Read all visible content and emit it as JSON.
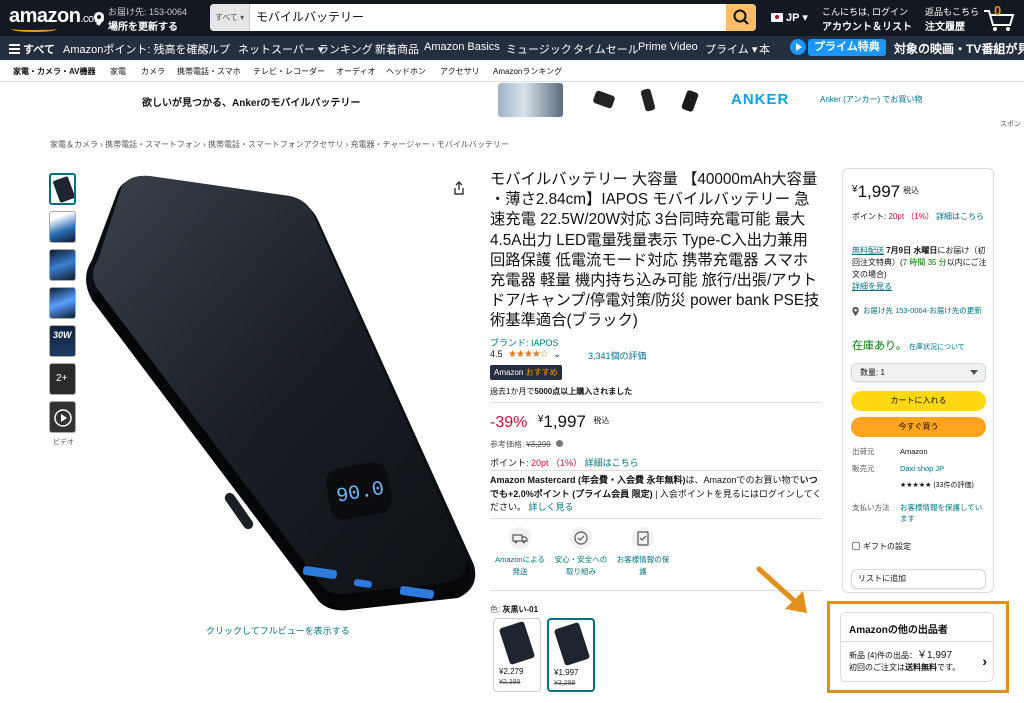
{
  "header": {
    "logo": "amazon",
    "logo_tld": ".co.jp",
    "deliver_to": "お届け先: 153-0064",
    "deliver_update": "場所を更新する",
    "search_category": "すべて",
    "search_value": "モバイルバッテリー",
    "lang": "JP",
    "account_top": "こんにちは, ログイン",
    "account_bottom": "アカウント＆リスト",
    "orders_top": "返品もこちら",
    "orders_bottom": "注文履歴",
    "cart_count": "0",
    "cart_label": "カート"
  },
  "nav": {
    "all": "すべて",
    "items": [
      "Amazonポイント: 残高を確認",
      "ヘルプ",
      "ネットスーパー",
      "ランキング",
      "新着商品",
      "Amazon Basics",
      "ミュージック",
      "タイムセール",
      "Prime Video",
      "プライム",
      "本"
    ],
    "prime_badge": "プライム特典",
    "prime_text": "対象の映画・TV番組が見"
  },
  "subnav": [
    "家電・カメラ・AV機器",
    "家電",
    "カメラ",
    "携帯電話・スマホ",
    "テレビ・レコーダー",
    "オーディオ",
    "ヘッドホン",
    "アクセサリ",
    "Amazonランキング"
  ],
  "ad": {
    "text": "欲しいが見つかる、Ankerのモバイルバッテリー",
    "brand": "ANKER",
    "link": "Anker (アンカー) でお買い物",
    "sponsored": "スポン"
  },
  "breadcrumb": "家電＆カメラ › 携帯電話・スマートフォン › 携帯電話・スマートフォンアクセサリ › 充電器・チャージャー › モバイルバッテリー",
  "gallery": {
    "video_label": "ビデオ",
    "fullview": "クリックしてフルビューを表示する",
    "thumb_text_30w": "30W",
    "thumb_text_2plus": "2+",
    "display_text": "90.0"
  },
  "product": {
    "title": "モバイルバッテリー 大容量 【40000mAh大容量 ・薄さ2.84cm】IAPOS モバイルバッテリー 急速充電 22.5W/20W対応 3台同時充電可能 最大4.5A出力 LED電量残量表示 Type-C入出力兼用 回路保護 低電流モード対応 携帯充電器 スマホ充電器 軽量 機内持ち込み可能 旅行/出張/アウトドア/キャンプ/停電対策/防災 power bank PSE技術基準適合(ブラック)",
    "brand": "ブランド: IAPOS",
    "rating": "4.5",
    "stars": "★★★★☆",
    "rating_count": "3,341個の評価",
    "badge_prefix": "Amazon",
    "badge_suffix": "おすすめ",
    "sold_prefix": "過去1か月で",
    "sold_bold": "5000点以上購入されました",
    "discount": "-39%",
    "price": "1,997",
    "yen": "¥",
    "tax": "税込",
    "ref_label": "参考価格:",
    "ref_price": "¥3,299",
    "points_label": "ポイント:",
    "points_value": "20pt （1%）",
    "points_link": "詳細はこちら",
    "mc_bold1": "Amazon Mastercard (年会費・入会費 永年無料)",
    "mc_text1": "は、Amazonでのお買い物で",
    "mc_bold2": "いつでも+2.0%ポイント (プライム会員 限定)",
    "mc_text2": " | 入会ポイントを見るにはログインしてください。",
    "mc_link": "詳しく見る",
    "features": [
      {
        "l1": "Amazonによる",
        "l2": "発送"
      },
      {
        "l1": "安心・安全への",
        "l2": "取り組み"
      },
      {
        "l1": "お客様情報の保",
        "l2": "護"
      }
    ],
    "color_label": "色:",
    "color_value": "灰黒い-01",
    "swatches": [
      {
        "price": "¥2,279",
        "old": "¥2,399"
      },
      {
        "price": "¥1,997",
        "old": "¥3,299"
      }
    ]
  },
  "buybox": {
    "yen": "¥",
    "price": "1,997",
    "tax": "税込",
    "points_label": "ポイント:",
    "points_value": "20pt （1%）",
    "points_link": "詳細はこちら",
    "free_ship": "無料配送",
    "delivery_date": "7月9日 水曜日",
    "delivery_text1": "にお届け（初回注文特典）(",
    "delivery_time": "7 時間 35 分",
    "delivery_text2": "以内にご注文の場合)",
    "detail_link": "詳細を見る",
    "address_link": "お届け先 153-0064-お届け先の更新",
    "instock": "在庫あり。",
    "stock_link": "在庫状況について",
    "qty": "数量: 1",
    "add_cart": "カートに入れる",
    "buy_now": "今すぐ買う",
    "info": [
      {
        "key": "出荷元",
        "val": "Amazon"
      },
      {
        "key": "販売元",
        "val": "Daxi shop JP"
      },
      {
        "key": "",
        "val": "★★★★★ (33件の評価)"
      },
      {
        "key": "支払い方法",
        "val": "お客様情報を保護しています"
      }
    ],
    "gift": "ギフトの設定",
    "add_list": "リストに追加"
  },
  "other_sellers": {
    "title": "Amazonの他の出品者",
    "new_label": "新品 (4)件の出品：",
    "price": "￥1,997",
    "free_text1": "初回のご注文は",
    "free_bold": "送料無料",
    "free_text2": "です。"
  },
  "colors": {
    "accent": "#ff9900",
    "link": "#007185",
    "price_red": "#cc0c39",
    "highlight_box": "#e0901d",
    "add_cart": "#ffd814",
    "buy_now": "#ffa41c"
  }
}
